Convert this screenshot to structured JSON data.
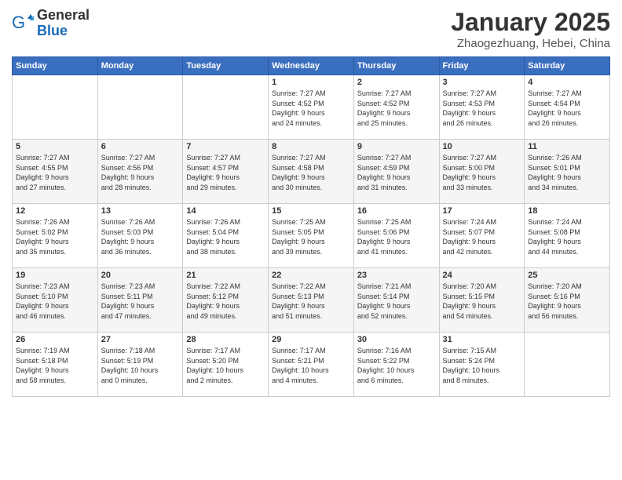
{
  "header": {
    "logo_general": "General",
    "logo_blue": "Blue",
    "title": "January 2025",
    "subtitle": "Zhaogezhuang, Hebei, China"
  },
  "weekdays": [
    "Sunday",
    "Monday",
    "Tuesday",
    "Wednesday",
    "Thursday",
    "Friday",
    "Saturday"
  ],
  "weeks": [
    [
      {
        "day": "",
        "info": ""
      },
      {
        "day": "",
        "info": ""
      },
      {
        "day": "",
        "info": ""
      },
      {
        "day": "1",
        "info": "Sunrise: 7:27 AM\nSunset: 4:52 PM\nDaylight: 9 hours\nand 24 minutes."
      },
      {
        "day": "2",
        "info": "Sunrise: 7:27 AM\nSunset: 4:52 PM\nDaylight: 9 hours\nand 25 minutes."
      },
      {
        "day": "3",
        "info": "Sunrise: 7:27 AM\nSunset: 4:53 PM\nDaylight: 9 hours\nand 26 minutes."
      },
      {
        "day": "4",
        "info": "Sunrise: 7:27 AM\nSunset: 4:54 PM\nDaylight: 9 hours\nand 26 minutes."
      }
    ],
    [
      {
        "day": "5",
        "info": "Sunrise: 7:27 AM\nSunset: 4:55 PM\nDaylight: 9 hours\nand 27 minutes."
      },
      {
        "day": "6",
        "info": "Sunrise: 7:27 AM\nSunset: 4:56 PM\nDaylight: 9 hours\nand 28 minutes."
      },
      {
        "day": "7",
        "info": "Sunrise: 7:27 AM\nSunset: 4:57 PM\nDaylight: 9 hours\nand 29 minutes."
      },
      {
        "day": "8",
        "info": "Sunrise: 7:27 AM\nSunset: 4:58 PM\nDaylight: 9 hours\nand 30 minutes."
      },
      {
        "day": "9",
        "info": "Sunrise: 7:27 AM\nSunset: 4:59 PM\nDaylight: 9 hours\nand 31 minutes."
      },
      {
        "day": "10",
        "info": "Sunrise: 7:27 AM\nSunset: 5:00 PM\nDaylight: 9 hours\nand 33 minutes."
      },
      {
        "day": "11",
        "info": "Sunrise: 7:26 AM\nSunset: 5:01 PM\nDaylight: 9 hours\nand 34 minutes."
      }
    ],
    [
      {
        "day": "12",
        "info": "Sunrise: 7:26 AM\nSunset: 5:02 PM\nDaylight: 9 hours\nand 35 minutes."
      },
      {
        "day": "13",
        "info": "Sunrise: 7:26 AM\nSunset: 5:03 PM\nDaylight: 9 hours\nand 36 minutes."
      },
      {
        "day": "14",
        "info": "Sunrise: 7:26 AM\nSunset: 5:04 PM\nDaylight: 9 hours\nand 38 minutes."
      },
      {
        "day": "15",
        "info": "Sunrise: 7:25 AM\nSunset: 5:05 PM\nDaylight: 9 hours\nand 39 minutes."
      },
      {
        "day": "16",
        "info": "Sunrise: 7:25 AM\nSunset: 5:06 PM\nDaylight: 9 hours\nand 41 minutes."
      },
      {
        "day": "17",
        "info": "Sunrise: 7:24 AM\nSunset: 5:07 PM\nDaylight: 9 hours\nand 42 minutes."
      },
      {
        "day": "18",
        "info": "Sunrise: 7:24 AM\nSunset: 5:08 PM\nDaylight: 9 hours\nand 44 minutes."
      }
    ],
    [
      {
        "day": "19",
        "info": "Sunrise: 7:23 AM\nSunset: 5:10 PM\nDaylight: 9 hours\nand 46 minutes."
      },
      {
        "day": "20",
        "info": "Sunrise: 7:23 AM\nSunset: 5:11 PM\nDaylight: 9 hours\nand 47 minutes."
      },
      {
        "day": "21",
        "info": "Sunrise: 7:22 AM\nSunset: 5:12 PM\nDaylight: 9 hours\nand 49 minutes."
      },
      {
        "day": "22",
        "info": "Sunrise: 7:22 AM\nSunset: 5:13 PM\nDaylight: 9 hours\nand 51 minutes."
      },
      {
        "day": "23",
        "info": "Sunrise: 7:21 AM\nSunset: 5:14 PM\nDaylight: 9 hours\nand 52 minutes."
      },
      {
        "day": "24",
        "info": "Sunrise: 7:20 AM\nSunset: 5:15 PM\nDaylight: 9 hours\nand 54 minutes."
      },
      {
        "day": "25",
        "info": "Sunrise: 7:20 AM\nSunset: 5:16 PM\nDaylight: 9 hours\nand 56 minutes."
      }
    ],
    [
      {
        "day": "26",
        "info": "Sunrise: 7:19 AM\nSunset: 5:18 PM\nDaylight: 9 hours\nand 58 minutes."
      },
      {
        "day": "27",
        "info": "Sunrise: 7:18 AM\nSunset: 5:19 PM\nDaylight: 10 hours\nand 0 minutes."
      },
      {
        "day": "28",
        "info": "Sunrise: 7:17 AM\nSunset: 5:20 PM\nDaylight: 10 hours\nand 2 minutes."
      },
      {
        "day": "29",
        "info": "Sunrise: 7:17 AM\nSunset: 5:21 PM\nDaylight: 10 hours\nand 4 minutes."
      },
      {
        "day": "30",
        "info": "Sunrise: 7:16 AM\nSunset: 5:22 PM\nDaylight: 10 hours\nand 6 minutes."
      },
      {
        "day": "31",
        "info": "Sunrise: 7:15 AM\nSunset: 5:24 PM\nDaylight: 10 hours\nand 8 minutes."
      },
      {
        "day": "",
        "info": ""
      }
    ]
  ]
}
